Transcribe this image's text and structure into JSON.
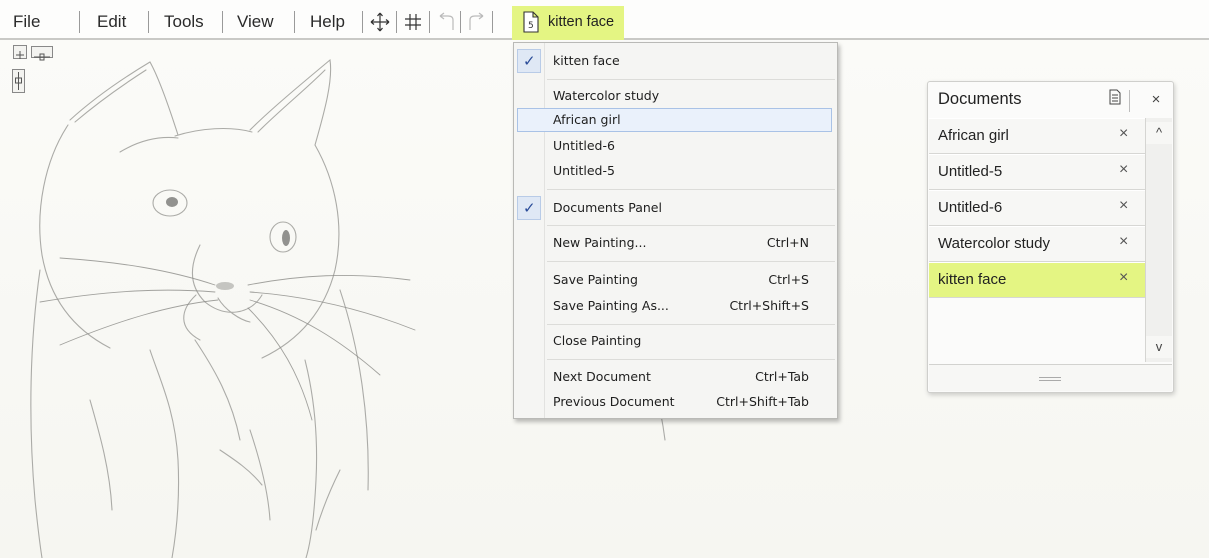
{
  "menubar": {
    "items": [
      "File",
      "Edit",
      "Tools",
      "View",
      "Help"
    ],
    "current_document": "kitten face"
  },
  "menu": {
    "open_documents": [
      {
        "label": "kitten face",
        "checked": true
      },
      {
        "label": "Watercolor study"
      },
      {
        "label": "African girl",
        "highlighted": true
      },
      {
        "label": "Untitled-6"
      },
      {
        "label": "Untitled-5"
      }
    ],
    "documents_panel": {
      "label": "Documents Panel",
      "checked": true
    },
    "new_painting": {
      "label": "New Painting...",
      "shortcut": "Ctrl+N"
    },
    "save_painting": {
      "label": "Save Painting",
      "shortcut": "Ctrl+S"
    },
    "save_painting_as": {
      "label": "Save Painting As...",
      "shortcut": "Ctrl+Shift+S"
    },
    "close_painting": {
      "label": "Close Painting"
    },
    "next_document": {
      "label": "Next Document",
      "shortcut": "Ctrl+Tab"
    },
    "previous_document": {
      "label": "Previous Document",
      "shortcut": "Ctrl+Shift+Tab"
    }
  },
  "documents_panel": {
    "title": "Documents",
    "items": [
      {
        "label": "African girl"
      },
      {
        "label": "Untitled-5"
      },
      {
        "label": "Untitled-6"
      },
      {
        "label": "Watercolor study"
      },
      {
        "label": "kitten face",
        "active": true
      }
    ],
    "scroll_up": "^",
    "scroll_down": "v",
    "close_glyph": "×"
  },
  "icons": {
    "menubar_tools": [
      "move-icon",
      "grid-icon",
      "undo-icon",
      "redo-icon",
      "document-icon"
    ],
    "canvas_tools": [
      "zoom-icon",
      "horizontal-slider-icon",
      "vertical-slider-icon"
    ],
    "panel_header": [
      "document-list-icon",
      "close-icon"
    ]
  },
  "colors": {
    "accent": "#e4f583",
    "check": "#2b4d99",
    "sketch": "#9e9e9a"
  }
}
